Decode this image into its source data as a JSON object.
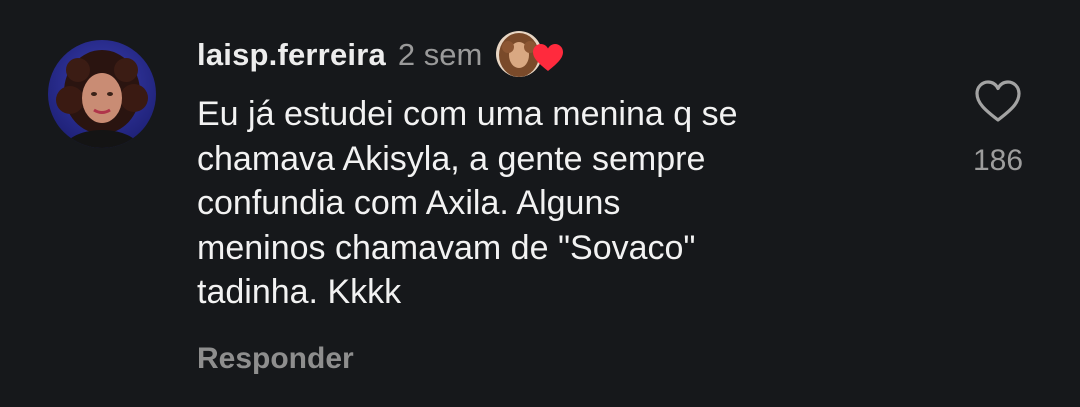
{
  "comment": {
    "username": "laisp.ferreira",
    "time": "2 sem",
    "text_lines": [
      "Eu já estudei com uma menina q se",
      "chamava Akisyla, a gente sempre",
      "confundia com Axila. Alguns",
      "meninos chamavam de \"Sovaco\"",
      "tadinha. Kkkk"
    ],
    "reply_label": "Responder",
    "like_count": "186"
  },
  "icons": {
    "avatar": "user-avatar",
    "reaction": "creator-liked-heart-icon",
    "like": "heart-outline-icon"
  },
  "colors": {
    "background": "#16181b",
    "heart_red": "#ff2a3d",
    "muted": "#9a9a9a"
  }
}
